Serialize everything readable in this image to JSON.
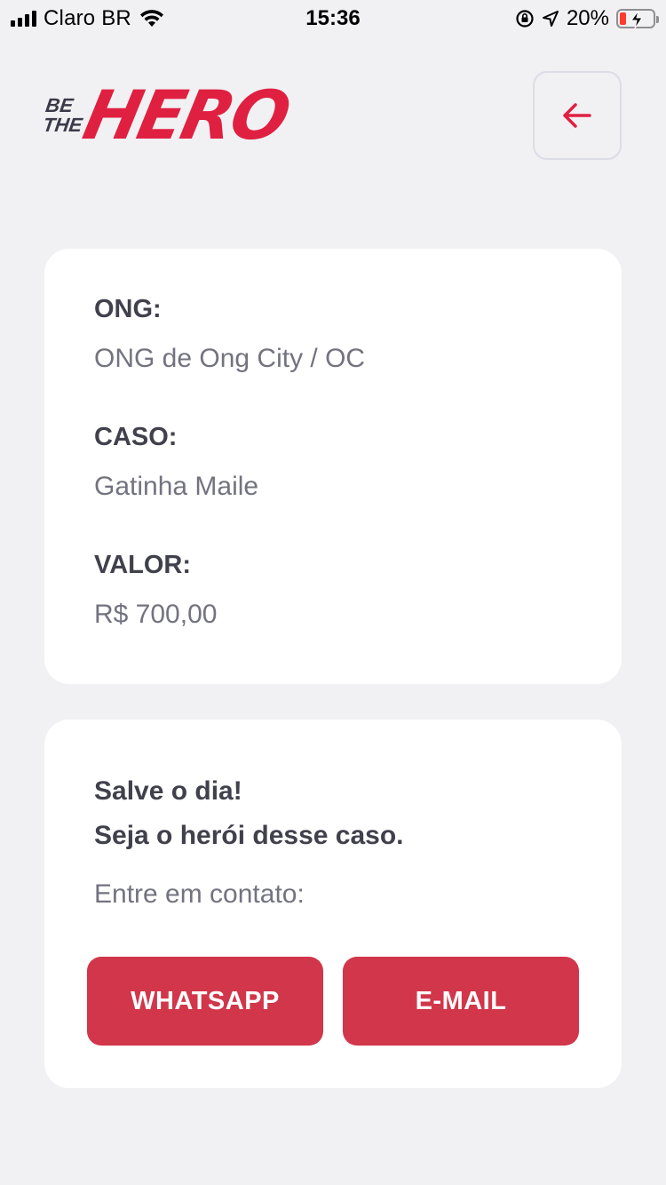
{
  "status_bar": {
    "carrier": "Claro BR",
    "time": "15:36",
    "battery_percent": "20%",
    "battery_level": 0.2,
    "icons": [
      "signal-icon",
      "wifi-icon",
      "orientation-lock-icon",
      "location-icon",
      "battery-icon"
    ]
  },
  "header": {
    "logo_small_top": "BE",
    "logo_small_bottom": "THE",
    "logo_big": "HERO",
    "back_icon": "arrow-left-icon"
  },
  "incident": {
    "ong_label": "ONG:",
    "ong_value": "ONG de Ong City / OC",
    "case_label": "CASO:",
    "case_value": "Gatinha Maile",
    "value_label": "VALOR:",
    "value_value": "R$ 700,00"
  },
  "contact": {
    "title_line1": "Salve o dia!",
    "title_line2": "Seja o herói desse caso.",
    "description": "Entre em contato:",
    "whatsapp_label": "WHATSAPP",
    "email_label": "E-MAIL"
  },
  "colors": {
    "brand": "#e02041",
    "button": "#d1364a",
    "background": "#f1f1f3"
  }
}
